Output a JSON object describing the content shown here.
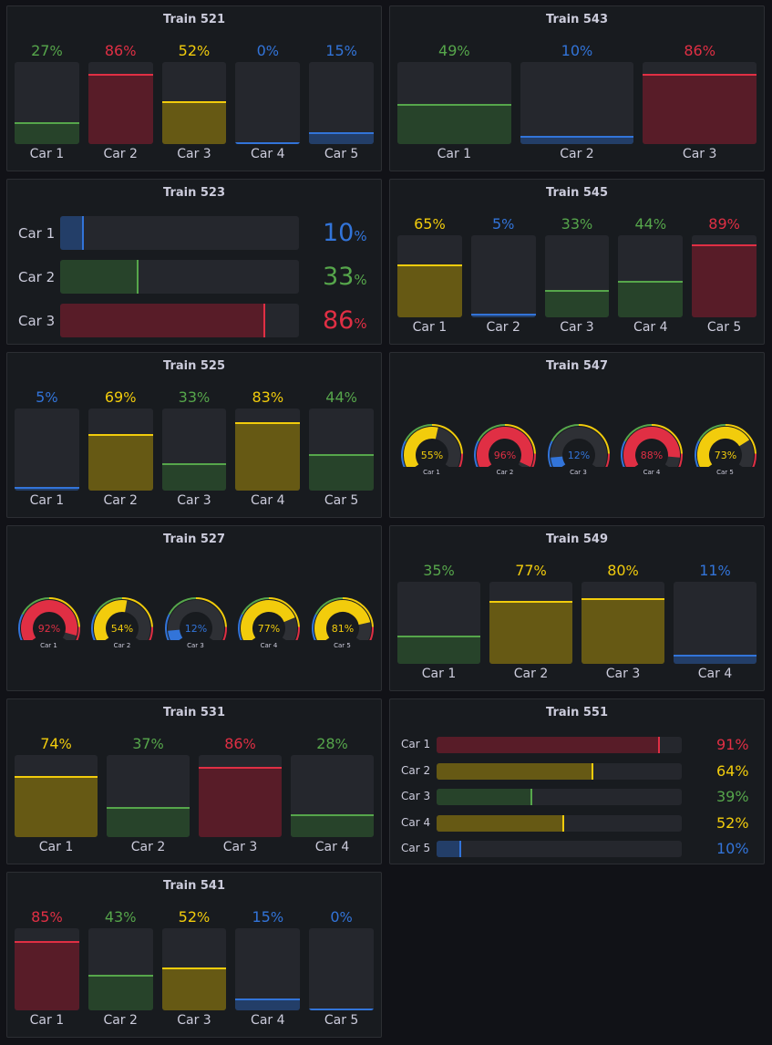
{
  "colors": {
    "green": "#56a64b",
    "yellow": "#f2cc0c",
    "red": "#e02f44",
    "blue": "#3274d9"
  },
  "panels": [
    {
      "id": "train-521",
      "title": "Train 521",
      "type": "vbar",
      "unit": "%",
      "cars": [
        {
          "label": "Car 1",
          "value": 27
        },
        {
          "label": "Car 2",
          "value": 86
        },
        {
          "label": "Car 3",
          "value": 52
        },
        {
          "label": "Car 4",
          "value": 0
        },
        {
          "label": "Car 5",
          "value": 15
        }
      ]
    },
    {
      "id": "train-543",
      "title": "Train 543",
      "type": "vbar",
      "unit": "%",
      "cars": [
        {
          "label": "Car 1",
          "value": 49
        },
        {
          "label": "Car 2",
          "value": 10
        },
        {
          "label": "Car 3",
          "value": 86
        }
      ]
    },
    {
      "id": "train-523",
      "title": "Train 523",
      "type": "hbar-large",
      "unit": "%",
      "cars": [
        {
          "label": "Car 1",
          "value": 10
        },
        {
          "label": "Car 2",
          "value": 33
        },
        {
          "label": "Car 3",
          "value": 86
        }
      ]
    },
    {
      "id": "train-545",
      "title": "Train 545",
      "type": "vbar",
      "unit": "%",
      "cars": [
        {
          "label": "Car 1",
          "value": 65
        },
        {
          "label": "Car 2",
          "value": 5
        },
        {
          "label": "Car 3",
          "value": 33
        },
        {
          "label": "Car 4",
          "value": 44
        },
        {
          "label": "Car 5",
          "value": 89
        }
      ]
    },
    {
      "id": "train-525",
      "title": "Train 525",
      "type": "vbar",
      "unit": "%",
      "cars": [
        {
          "label": "Car 1",
          "value": 5
        },
        {
          "label": "Car 2",
          "value": 69
        },
        {
          "label": "Car 3",
          "value": 33
        },
        {
          "label": "Car 4",
          "value": 83
        },
        {
          "label": "Car 5",
          "value": 44
        }
      ]
    },
    {
      "id": "train-547",
      "title": "Train 547",
      "type": "gauge",
      "unit": "%",
      "cars": [
        {
          "label": "Car 1",
          "value": 55
        },
        {
          "label": "Car 2",
          "value": 96
        },
        {
          "label": "Car 3",
          "value": 12
        },
        {
          "label": "Car 4",
          "value": 88
        },
        {
          "label": "Car 5",
          "value": 73
        }
      ]
    },
    {
      "id": "train-527",
      "title": "Train 527",
      "type": "gauge",
      "unit": "%",
      "cars": [
        {
          "label": "Car 1",
          "value": 92
        },
        {
          "label": "Car 2",
          "value": 54
        },
        {
          "label": "Car 3",
          "value": 12
        },
        {
          "label": "Car 4",
          "value": 77
        },
        {
          "label": "Car 5",
          "value": 81
        }
      ]
    },
    {
      "id": "train-549",
      "title": "Train 549",
      "type": "vbar",
      "unit": "%",
      "cars": [
        {
          "label": "Car 1",
          "value": 35
        },
        {
          "label": "Car 2",
          "value": 77
        },
        {
          "label": "Car 3",
          "value": 80
        },
        {
          "label": "Car 4",
          "value": 11
        }
      ]
    },
    {
      "id": "train-531",
      "title": "Train 531",
      "type": "vbar",
      "unit": "%",
      "cars": [
        {
          "label": "Car 1",
          "value": 74
        },
        {
          "label": "Car 2",
          "value": 37
        },
        {
          "label": "Car 3",
          "value": 86
        },
        {
          "label": "Car 4",
          "value": 28
        }
      ]
    },
    {
      "id": "train-551",
      "title": "Train 551",
      "type": "hbar-small",
      "unit": "%",
      "cars": [
        {
          "label": "Car 1",
          "value": 91
        },
        {
          "label": "Car 2",
          "value": 64
        },
        {
          "label": "Car 3",
          "value": 39
        },
        {
          "label": "Car 4",
          "value": 52
        },
        {
          "label": "Car 5",
          "value": 10
        }
      ]
    },
    {
      "id": "train-541",
      "title": "Train 541",
      "type": "vbar",
      "unit": "%",
      "cars": [
        {
          "label": "Car 1",
          "value": 85
        },
        {
          "label": "Car 2",
          "value": 43
        },
        {
          "label": "Car 3",
          "value": 52
        },
        {
          "label": "Car 4",
          "value": 15
        },
        {
          "label": "Car 5",
          "value": 0
        }
      ]
    }
  ]
}
